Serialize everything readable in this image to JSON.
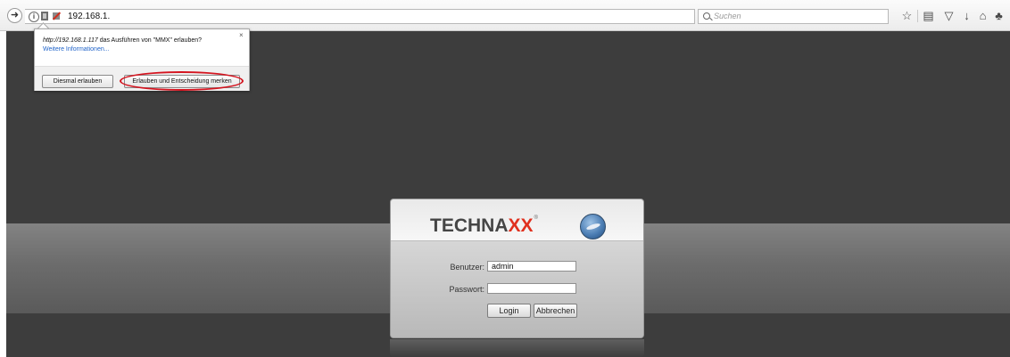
{
  "browser": {
    "url": "192.168.1.",
    "search_placeholder": "Suchen",
    "reload_glyph": "C"
  },
  "plugin_popup": {
    "message_url": "http://192.168.1.117",
    "message_text": " das Ausführen von \"MMX\" erlauben?",
    "more_info_link": "Weitere Informationen...",
    "close_glyph": "×",
    "allow_once_label": "Diesmal erlauben",
    "allow_remember_label": "Erlauben und Entscheidung merken",
    "highlight_color": "#d4141f"
  },
  "login": {
    "brand_prefix": "TECHNA",
    "brand_accent": "XX",
    "brand_mark": "®",
    "brand_accent_color": "#e0301e",
    "user_label": "Benutzer:",
    "user_value": "admin",
    "password_label": "Passwort:",
    "password_value": "",
    "login_button": "Login",
    "cancel_button": "Abbrechen"
  },
  "icons": [
    "back-icon",
    "info-icon",
    "plugin-icon",
    "plugin-blocked-icon",
    "reload-icon",
    "search-icon",
    "bookmark-star-icon",
    "reading-list-icon",
    "pocket-icon",
    "downloads-icon",
    "home-icon",
    "addons-icon"
  ]
}
